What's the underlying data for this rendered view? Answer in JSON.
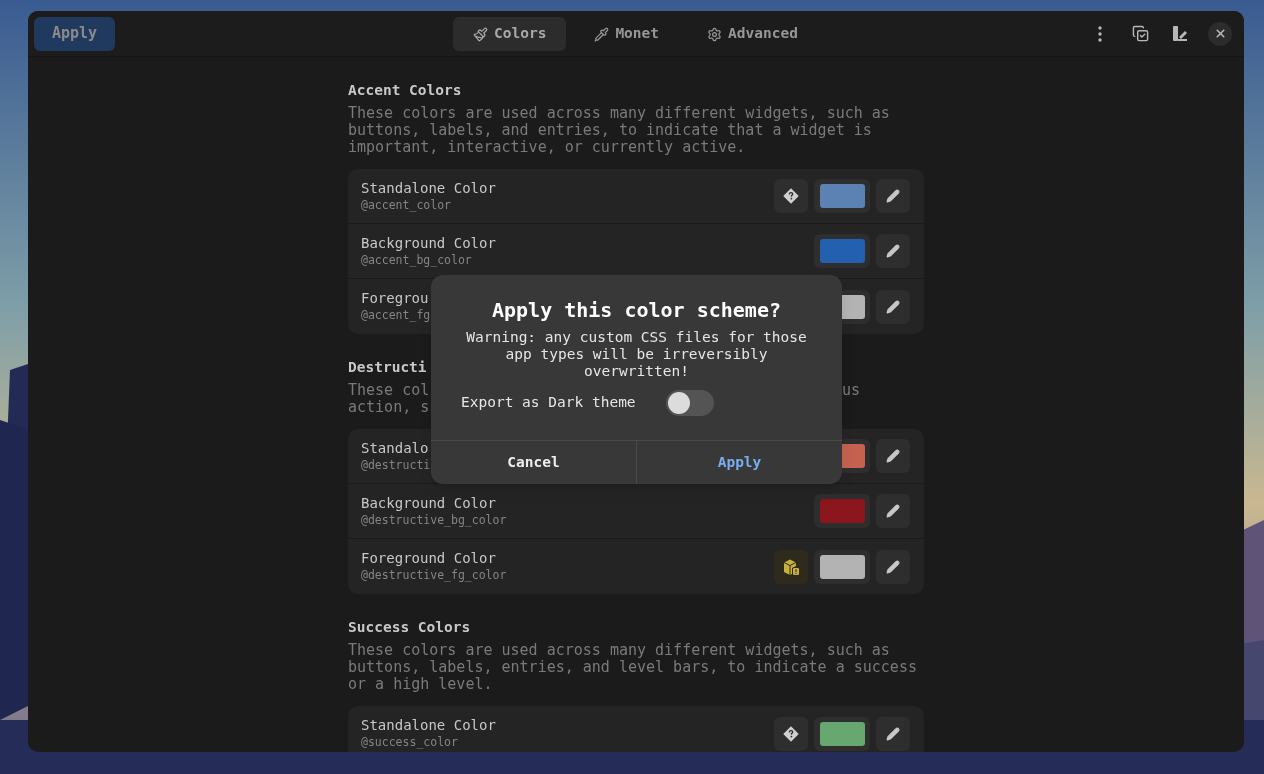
{
  "header": {
    "apply": "Apply",
    "tabs": [
      {
        "label": "Colors",
        "selected": true
      },
      {
        "label": "Monet",
        "selected": false
      },
      {
        "label": "Advanced",
        "selected": false
      }
    ]
  },
  "sections": [
    {
      "title": "Accent Colors",
      "description": "These colors are used across many different widgets, such as buttons, labels, and entries, to indicate that a widget is important, interactive, or currently active.",
      "rows": [
        {
          "name": "Standalone Color",
          "variable": "@accent_color",
          "kind": "unknown",
          "color": "#5b82b3"
        },
        {
          "name": "Background Color",
          "variable": "@accent_bg_color",
          "kind": "plain",
          "color": "#2361b0"
        },
        {
          "name": "Foregrou",
          "variable": "@accent_fg",
          "kind": "plain",
          "color": "#b3b3b3"
        }
      ]
    },
    {
      "title": "Destructi",
      "description_left": [
        "These col",
        "action, s"
      ],
      "description_right": [
        "us"
      ],
      "rows": [
        {
          "name": "Standalo",
          "variable": "@destructi",
          "kind": "plain",
          "color": "#c4614f"
        },
        {
          "name": "Background Color",
          "variable": "@destructive_bg_color",
          "kind": "plain",
          "color": "#8b161d"
        },
        {
          "name": "Foreground Color",
          "variable": "@destructive_fg_color",
          "kind": "warning",
          "color": "#b3b3b3"
        }
      ]
    },
    {
      "title": "Success Colors",
      "description": "These colors are used across many different widgets, such as buttons, labels, entries, and level bars, to indicate a success or a high level.",
      "rows": [
        {
          "name": "Standalone Color",
          "variable": "@success_color",
          "kind": "unknown",
          "color": "#66a870"
        }
      ]
    }
  ],
  "dialog": {
    "title": "Apply this color scheme?",
    "message": "Warning: any custom CSS files for those app types will be irreversibly overwritten!",
    "toggle": {
      "label": "Export as Dark theme",
      "on": false
    },
    "buttons": [
      {
        "label": "Cancel",
        "kind": "cancel"
      },
      {
        "label": "Apply",
        "kind": "suggested"
      }
    ]
  }
}
